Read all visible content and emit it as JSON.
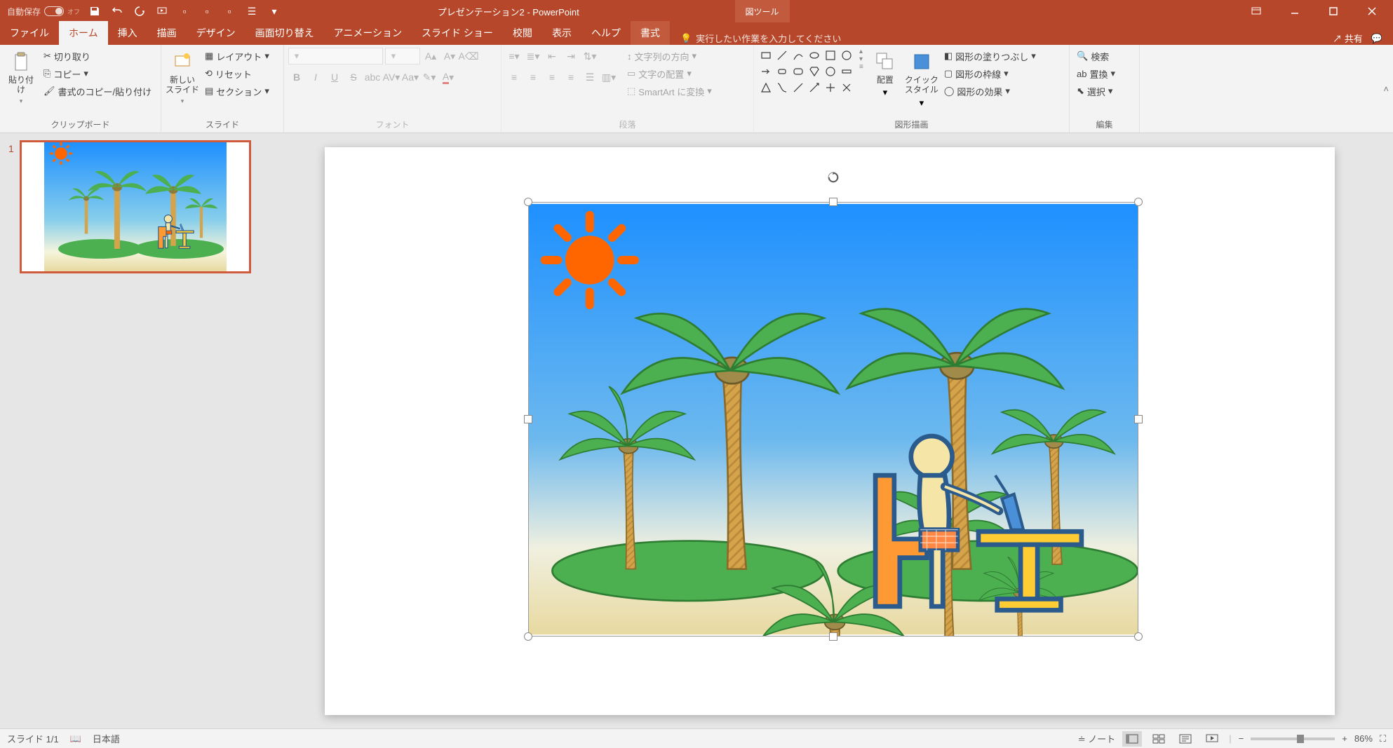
{
  "titlebar": {
    "autosave_label": "自動保存",
    "autosave_state": "オフ",
    "app_title": "プレゼンテーション2 - PowerPoint",
    "tool_tab": "図ツール"
  },
  "tabs": {
    "file": "ファイル",
    "home": "ホーム",
    "insert": "挿入",
    "draw": "描画",
    "design": "デザイン",
    "transitions": "画面切り替え",
    "animations": "アニメーション",
    "slideshow": "スライド ショー",
    "review": "校閲",
    "view": "表示",
    "help": "ヘルプ",
    "format": "書式",
    "tellme": "実行したい作業を入力してください",
    "share": "共有"
  },
  "ribbon": {
    "clipboard": {
      "paste": "貼り付け",
      "cut": "切り取り",
      "copy": "コピー",
      "format_painter": "書式のコピー/貼り付け",
      "label": "クリップボード"
    },
    "slides": {
      "new_slide": "新しい\nスライド",
      "layout": "レイアウト",
      "reset": "リセット",
      "section": "セクション",
      "label": "スライド"
    },
    "font": {
      "label": "フォント"
    },
    "paragraph": {
      "text_direction": "文字列の方向",
      "align_text": "文字の配置",
      "smartart": "SmartArt に変換",
      "label": "段落"
    },
    "drawing": {
      "arrange": "配置",
      "quick_styles": "クイック\nスタイル",
      "shape_fill": "図形の塗りつぶし",
      "shape_outline": "図形の枠線",
      "shape_effects": "図形の効果",
      "label": "図形描画"
    },
    "editing": {
      "find": "検索",
      "replace": "置換",
      "select": "選択",
      "label": "編集"
    }
  },
  "thumbnails": {
    "slide1_num": "1"
  },
  "statusbar": {
    "slide_info": "スライド 1/1",
    "language": "日本語",
    "notes": "ノート",
    "zoom": "86%"
  }
}
